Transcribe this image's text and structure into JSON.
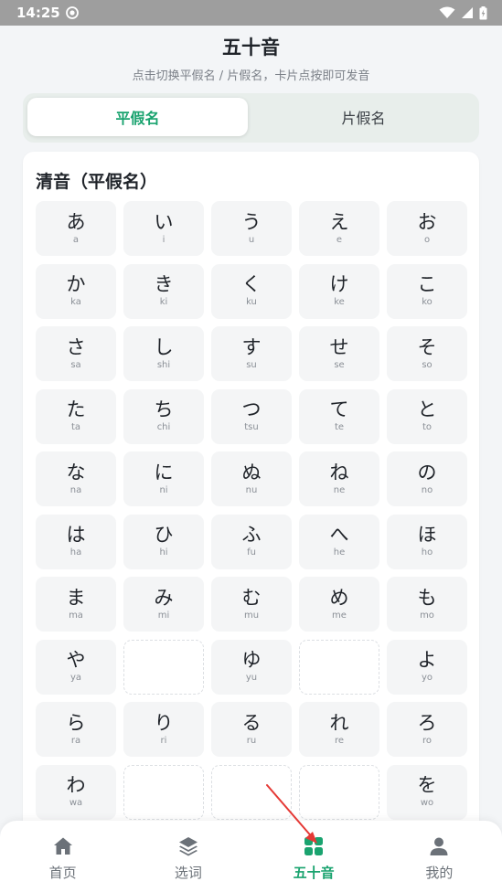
{
  "status_bar": {
    "time": "14:25"
  },
  "header": {
    "title": "五十音",
    "subtitle": "点击切换平假名 / 片假名，卡片点按即可发音"
  },
  "tabs": [
    {
      "label": "平假名",
      "active": true
    },
    {
      "label": "片假名",
      "active": false
    }
  ],
  "section": {
    "title": "清音（平假名）"
  },
  "kana_grid": [
    {
      "kana": "あ",
      "romaji": "a"
    },
    {
      "kana": "い",
      "romaji": "i"
    },
    {
      "kana": "う",
      "romaji": "u"
    },
    {
      "kana": "え",
      "romaji": "e"
    },
    {
      "kana": "お",
      "romaji": "o"
    },
    {
      "kana": "か",
      "romaji": "ka"
    },
    {
      "kana": "き",
      "romaji": "ki"
    },
    {
      "kana": "く",
      "romaji": "ku"
    },
    {
      "kana": "け",
      "romaji": "ke"
    },
    {
      "kana": "こ",
      "romaji": "ko"
    },
    {
      "kana": "さ",
      "romaji": "sa"
    },
    {
      "kana": "し",
      "romaji": "shi"
    },
    {
      "kana": "す",
      "romaji": "su"
    },
    {
      "kana": "せ",
      "romaji": "se"
    },
    {
      "kana": "そ",
      "romaji": "so"
    },
    {
      "kana": "た",
      "romaji": "ta"
    },
    {
      "kana": "ち",
      "romaji": "chi"
    },
    {
      "kana": "つ",
      "romaji": "tsu"
    },
    {
      "kana": "て",
      "romaji": "te"
    },
    {
      "kana": "と",
      "romaji": "to"
    },
    {
      "kana": "な",
      "romaji": "na"
    },
    {
      "kana": "に",
      "romaji": "ni"
    },
    {
      "kana": "ぬ",
      "romaji": "nu"
    },
    {
      "kana": "ね",
      "romaji": "ne"
    },
    {
      "kana": "の",
      "romaji": "no"
    },
    {
      "kana": "は",
      "romaji": "ha"
    },
    {
      "kana": "ひ",
      "romaji": "hi"
    },
    {
      "kana": "ふ",
      "romaji": "fu"
    },
    {
      "kana": "へ",
      "romaji": "he"
    },
    {
      "kana": "ほ",
      "romaji": "ho"
    },
    {
      "kana": "ま",
      "romaji": "ma"
    },
    {
      "kana": "み",
      "romaji": "mi"
    },
    {
      "kana": "む",
      "romaji": "mu"
    },
    {
      "kana": "め",
      "romaji": "me"
    },
    {
      "kana": "も",
      "romaji": "mo"
    },
    {
      "kana": "や",
      "romaji": "ya"
    },
    {
      "kana": "",
      "romaji": ""
    },
    {
      "kana": "ゆ",
      "romaji": "yu"
    },
    {
      "kana": "",
      "romaji": ""
    },
    {
      "kana": "よ",
      "romaji": "yo"
    },
    {
      "kana": "ら",
      "romaji": "ra"
    },
    {
      "kana": "り",
      "romaji": "ri"
    },
    {
      "kana": "る",
      "romaji": "ru"
    },
    {
      "kana": "れ",
      "romaji": "re"
    },
    {
      "kana": "ろ",
      "romaji": "ro"
    },
    {
      "kana": "わ",
      "romaji": "wa"
    },
    {
      "kana": "",
      "romaji": ""
    },
    {
      "kana": "",
      "romaji": ""
    },
    {
      "kana": "",
      "romaji": ""
    },
    {
      "kana": "を",
      "romaji": "wo"
    }
  ],
  "bottom_nav": [
    {
      "label": "首页",
      "icon": "home-icon",
      "active": false
    },
    {
      "label": "选词",
      "icon": "layers-icon",
      "active": false
    },
    {
      "label": "五十音",
      "icon": "grid-icon",
      "active": true
    },
    {
      "label": "我的",
      "icon": "user-icon",
      "active": false
    }
  ],
  "colors": {
    "accent": "#1aa36f",
    "annotation_arrow": "#e53935"
  }
}
